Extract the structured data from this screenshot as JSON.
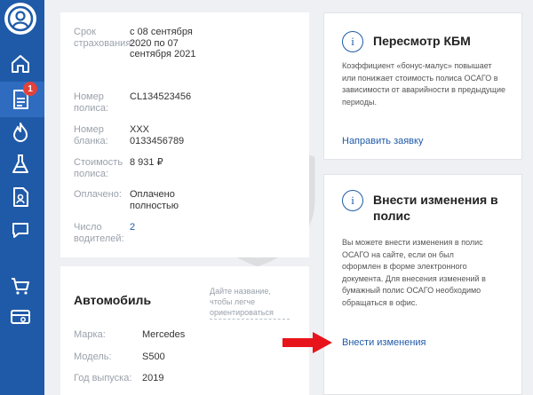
{
  "sidebar": {
    "badge": "1",
    "icons": [
      "avatar-icon",
      "home-icon",
      "policy-icon",
      "flame-icon",
      "flask-icon",
      "document-icon",
      "chat-icon",
      "cart-icon",
      "card-icon"
    ],
    "accent": "#1f5aa8",
    "badge_color": "#e2413c"
  },
  "policy": {
    "period_label": "Срок страхования:",
    "period_value": "с 08 сентября 2020 по 07 сентября 2021",
    "number_label": "Номер полиса:",
    "number_value": "CL134523456",
    "form_label": "Номер бланка:",
    "form_value": "XXX 0133456789",
    "cost_label": "Стоимость полиса:",
    "cost_value": "8 931 ₽",
    "paid_label": "Оплачено:",
    "paid_value": "Оплачено полностью",
    "drivers_label": "Число водителей:",
    "drivers_value": "2"
  },
  "car": {
    "title": "Автомобиль",
    "hint": "Дайте название, чтобы легче ориентироваться",
    "make_label": "Марка:",
    "make_value": "Mercedes",
    "model_label": "Модель:",
    "model_value": "S500",
    "year_label": "Год выпуска:",
    "year_value": "2019"
  },
  "kbm": {
    "title": "Пересмотр КБМ",
    "text": "Коэффициент «бонус-малус» повышает или понижает стоимость полиса ОСАГО в зависимости от аварийности в предыдущие периоды.",
    "link": "Направить заявку"
  },
  "changes": {
    "title": "Внести изменения в полис",
    "text": "Вы можете внести изменения в полис ОСАГО на сайте, если он был оформлен в форме электронного документа. Для внесения изменений в бумажный полис ОСАГО необходимо обращаться в офис.",
    "link": "Внести изменения"
  }
}
